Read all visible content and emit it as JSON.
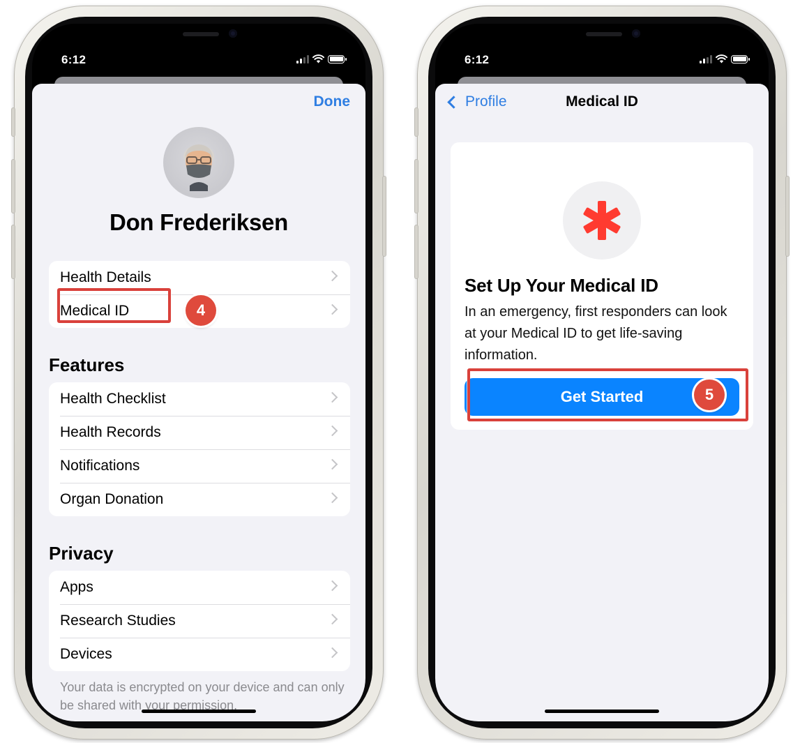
{
  "left_phone": {
    "status_time": "6:12",
    "done_label": "Done",
    "profile_name": "Don Frederiksen",
    "top_items": [
      {
        "label": "Health Details"
      },
      {
        "label": "Medical ID"
      }
    ],
    "features_title": "Features",
    "features_items": [
      {
        "label": "Health Checklist"
      },
      {
        "label": "Health Records"
      },
      {
        "label": "Notifications"
      },
      {
        "label": "Organ Donation"
      }
    ],
    "privacy_title": "Privacy",
    "privacy_items": [
      {
        "label": "Apps"
      },
      {
        "label": "Research Studies"
      },
      {
        "label": "Devices"
      }
    ],
    "footer_note": "Your data is encrypted on your device and can only be shared with your permission.",
    "step_badge": "4"
  },
  "right_phone": {
    "status_time": "6:12",
    "back_label": "Profile",
    "nav_title": "Medical ID",
    "card_title": "Set Up Your Medical ID",
    "card_body": "In an emergency, first responders can look at your Medical ID to get life-saving information.",
    "cta_label": "Get Started",
    "step_badge": "5"
  },
  "icons": {
    "asterisk": "medical-asterisk-icon",
    "avatar": "memoji-avatar"
  },
  "colors": {
    "accent_blue": "#2f7ee2",
    "cta_blue": "#0a84ff",
    "highlight_red": "#d9413b",
    "asterisk_red": "#ff3b30"
  }
}
